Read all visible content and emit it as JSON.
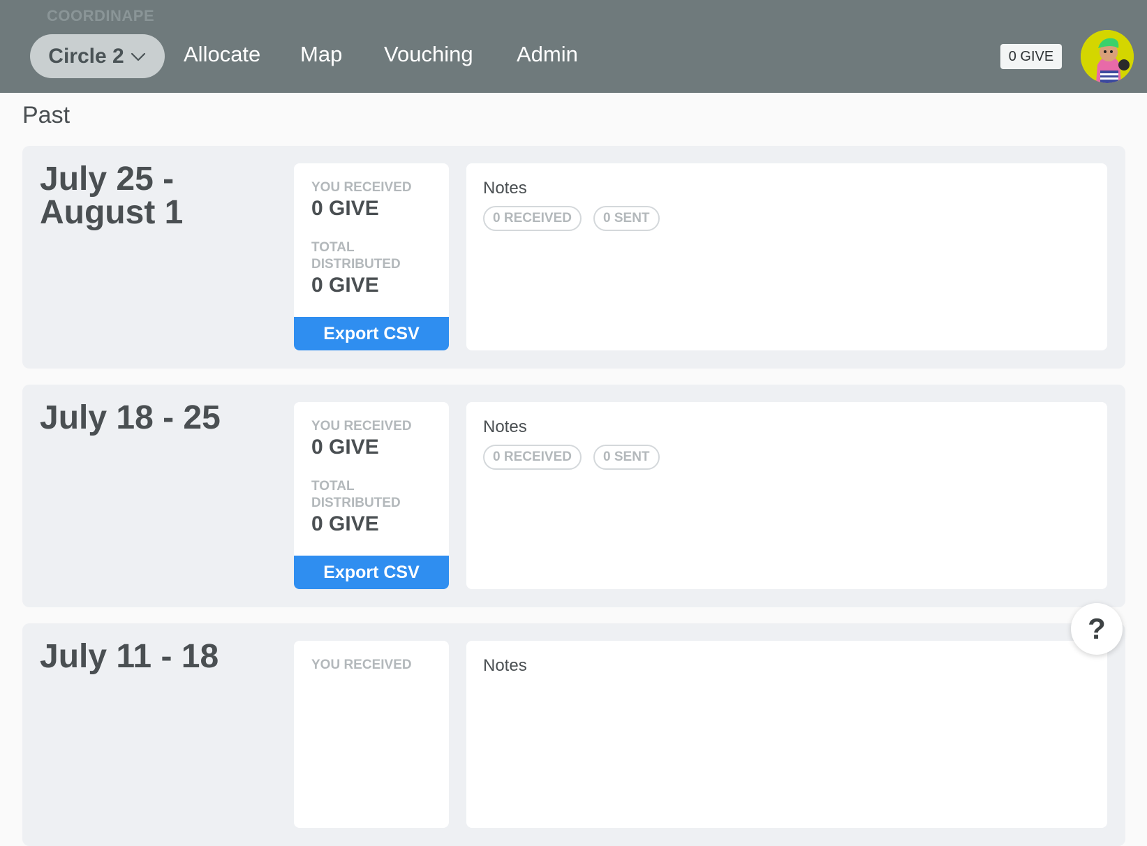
{
  "header": {
    "brand": "COORDINAPE",
    "circle_selector": "Circle 2",
    "nav": [
      "Allocate",
      "Map",
      "Vouching",
      "Admin"
    ],
    "give_balance": "0 GIVE",
    "colors": {
      "bar": "#6f7a7c",
      "accent": "#2f8ef0"
    }
  },
  "page": {
    "section_title": "Past"
  },
  "epochs": [
    {
      "date": "July 25 - August 1",
      "received_label": "YOU RECEIVED",
      "received_value": "0 GIVE",
      "distributed_label": "TOTAL DISTRIBUTED",
      "distributed_value": "0 GIVE",
      "export_label": "Export CSV",
      "notes_title": "Notes",
      "notes_received": "0 RECEIVED",
      "notes_sent": "0 SENT"
    },
    {
      "date": "July 18 - 25",
      "received_label": "YOU RECEIVED",
      "received_value": "0 GIVE",
      "distributed_label": "TOTAL DISTRIBUTED",
      "distributed_value": "0 GIVE",
      "export_label": "Export CSV",
      "notes_title": "Notes",
      "notes_received": "0 RECEIVED",
      "notes_sent": "0 SENT"
    },
    {
      "date": "July 11 - 18",
      "received_label": "YOU RECEIVED",
      "notes_title": "Notes"
    }
  ],
  "help": {
    "label": "?"
  }
}
